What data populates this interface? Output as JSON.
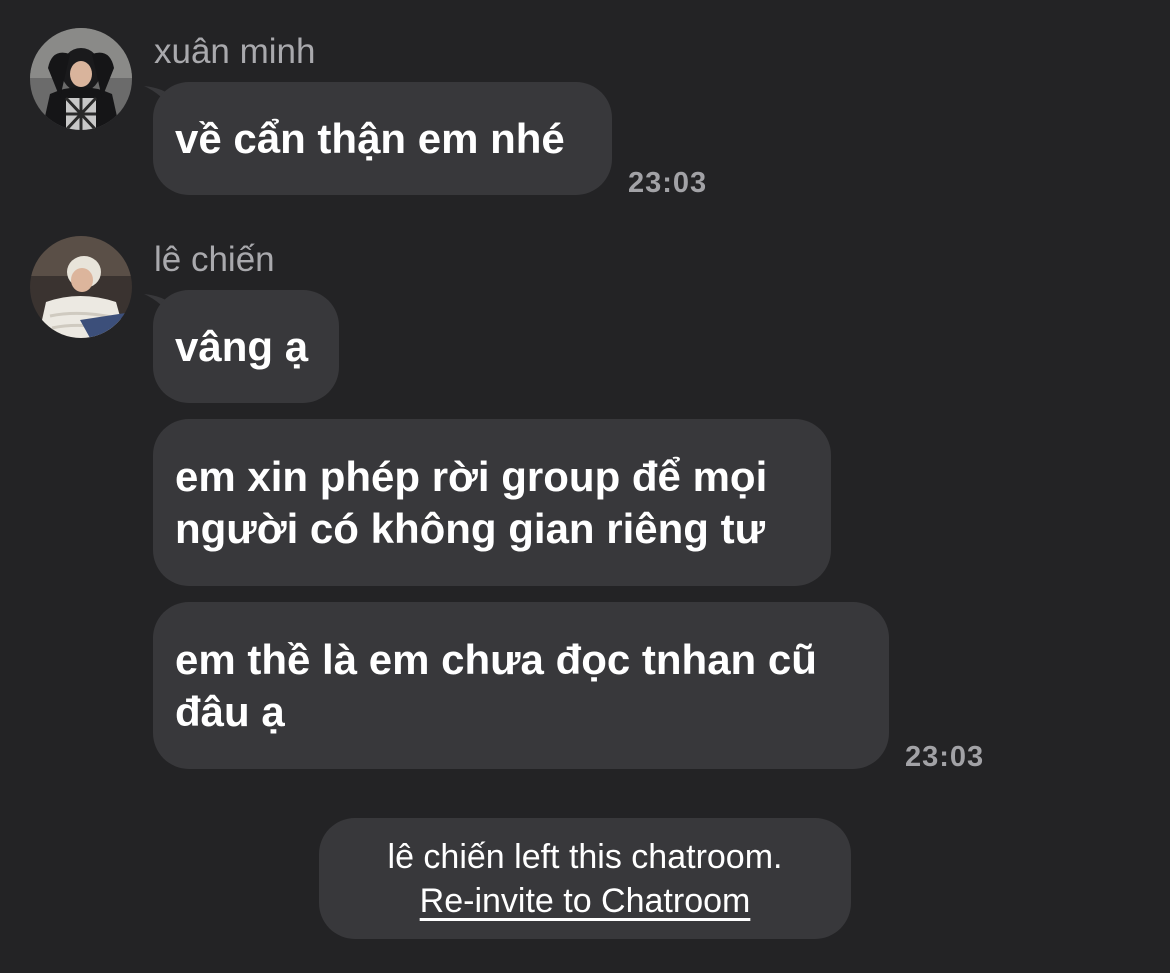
{
  "messages": [
    {
      "sender": "xuân minh",
      "bubbles": [
        "về cẩn thận em nhé"
      ],
      "time": "23:03"
    },
    {
      "sender": "lê chiến",
      "bubbles": [
        "vâng ạ",
        "em xin phép rời group để mọi\nngười có không gian riêng tư",
        "em thề là em chưa đọc tnhan cũ\nđâu ạ"
      ],
      "time": "23:03"
    }
  ],
  "system_notice": {
    "text": "lê chiến left this chatroom.",
    "link": "Re-invite to Chatroom"
  },
  "colors": {
    "background": "#232325",
    "bubble": "#38383b",
    "secondary_text": "#a9a9ad"
  }
}
